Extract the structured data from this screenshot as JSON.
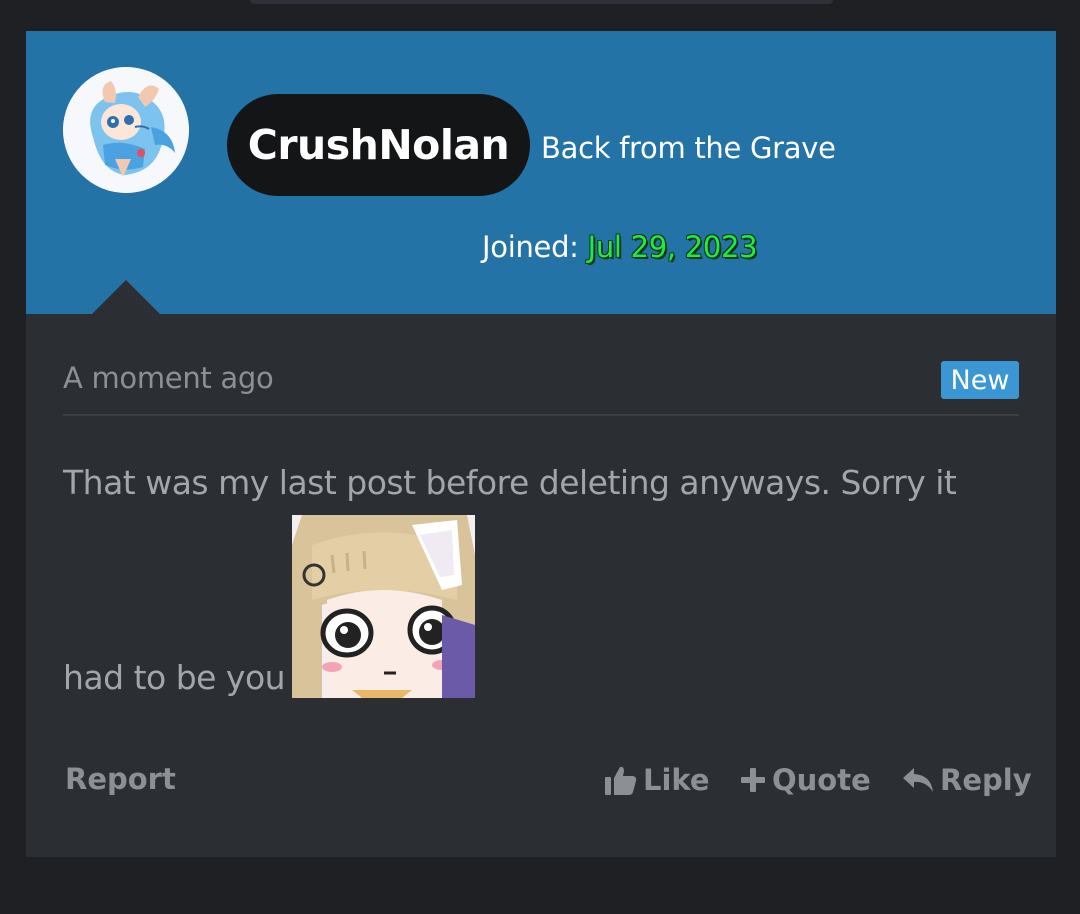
{
  "post": {
    "author": {
      "username": "CrushNolan",
      "title": "Back from the Grave",
      "joined_label": "Joined:",
      "joined_date": "Jul 29, 2023"
    },
    "timestamp": "A moment ago",
    "badge": "New",
    "message": {
      "line1": "That was my last post before deleting anyways. Sorry it",
      "line2": "had to be you"
    },
    "actions": {
      "report": "Report",
      "like": "Like",
      "quote": "Quote",
      "reply": "Reply"
    }
  },
  "colors": {
    "header_bg": "#2473a6",
    "card_bg": "#2b2e33",
    "page_bg": "#1e2024",
    "badge_bg": "#3a97d3",
    "joined_date": "#23e84a"
  },
  "icons": {
    "avatar": "avatar-image",
    "sticker": "anime-girl-sticker",
    "like": "thumbs-up-icon",
    "quote": "plus-icon",
    "reply": "reply-arrow-icon"
  }
}
